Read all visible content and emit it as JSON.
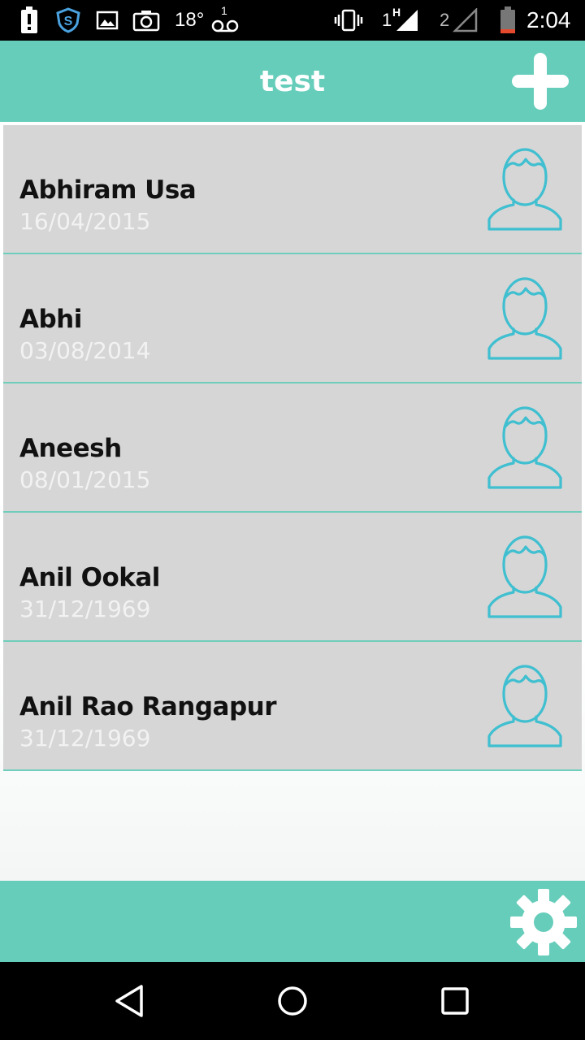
{
  "status_bar": {
    "temperature": "18°",
    "voicemail_count": "1",
    "sim1_label": "1",
    "sim1_network": "H",
    "sim2_label": "2",
    "time": "2:04"
  },
  "app_bar": {
    "title": "test",
    "add_icon": "plus-icon"
  },
  "contacts": [
    {
      "name": "Abhiram Usa",
      "date": "16/04/2015",
      "icon": "person-avatar-icon"
    },
    {
      "name": "Abhi",
      "date": "03/08/2014",
      "icon": "person-avatar-icon"
    },
    {
      "name": "Aneesh",
      "date": "08/01/2015",
      "icon": "person-avatar-icon"
    },
    {
      "name": "Anil Ookal",
      "date": "31/12/1969",
      "icon": "person-avatar-icon"
    },
    {
      "name": "Anil Rao Rangapur",
      "date": "31/12/1969",
      "icon": "person-avatar-icon"
    }
  ],
  "bottom_bar": {
    "settings_icon": "gear-icon"
  },
  "nav_bar": {
    "back_icon": "back-triangle-icon",
    "home_icon": "home-circle-icon",
    "recents_icon": "recents-square-icon"
  },
  "colors": {
    "accent": "#67cdbb",
    "row_background": "#d6d6d6",
    "avatar_stroke": "#3fbfd0",
    "date_text": "#f2f2f2"
  }
}
